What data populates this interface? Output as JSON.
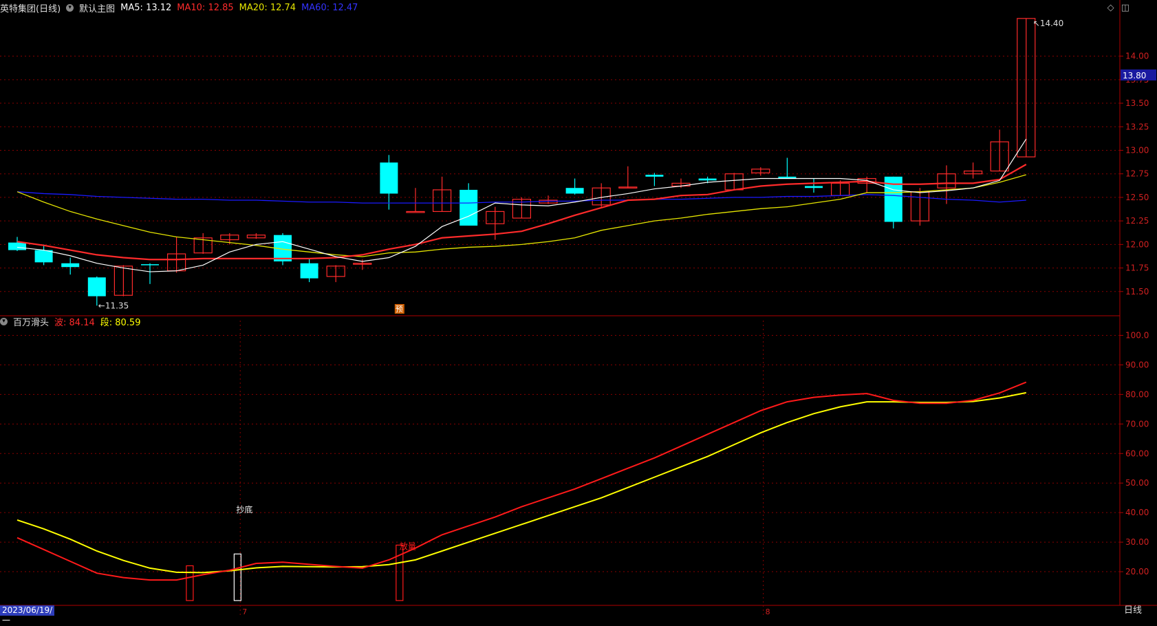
{
  "main_header": {
    "stock_name": "英特集团(日线)",
    "main_chart_label": "默认主图",
    "ma5_label": "MA5: 13.12",
    "ma10_label": "MA10: 12.85",
    "ma20_label": "MA20: 12.74",
    "ma60_label": "MA60: 12.47"
  },
  "sub_header": {
    "indicator_name": "百万滑头",
    "wave_label": "波: 84.14",
    "segment_label": "段: 80.59"
  },
  "bottom": {
    "date": "2023/06/19/一",
    "period": "日线",
    "month_markers": [
      "7",
      "8"
    ]
  },
  "current_price_label": "13.80",
  "colors": {
    "up": "#ff2b2b",
    "down": "#00ffff",
    "ma5": "#ffffff",
    "ma10": "#ff2b2b",
    "ma20": "#e6e600",
    "ma60": "#1a1aff",
    "wave": "#ff1a1a",
    "segment": "#ffff00",
    "grid": "#8b0000"
  },
  "chart_data": [
    {
      "type": "candlestick",
      "ylim": [
        11.25,
        14.45
      ],
      "ticks": [
        11.5,
        11.75,
        12.0,
        12.25,
        12.5,
        12.75,
        13.0,
        13.25,
        13.5,
        13.75,
        14.0
      ],
      "tick_labels": [
        "11.50",
        "11.75",
        "12.00",
        "12.25",
        "12.50",
        "12.75",
        "13.00",
        "13.25",
        "13.50",
        "13.75",
        "14.00"
      ],
      "ohlc": [
        [
          12.02,
          12.08,
          11.93,
          11.94
        ],
        [
          11.94,
          12.0,
          11.78,
          11.81
        ],
        [
          11.8,
          11.86,
          11.68,
          11.76
        ],
        [
          11.65,
          11.66,
          11.35,
          11.45
        ],
        [
          11.46,
          11.78,
          11.45,
          11.77
        ],
        [
          11.79,
          11.8,
          11.58,
          11.78
        ],
        [
          11.72,
          12.08,
          11.7,
          11.9
        ],
        [
          11.91,
          12.12,
          11.9,
          12.07
        ],
        [
          12.05,
          12.12,
          12.0,
          12.1
        ],
        [
          12.07,
          12.12,
          12.06,
          12.1
        ],
        [
          12.1,
          12.12,
          11.78,
          11.82
        ],
        [
          11.8,
          11.85,
          11.6,
          11.64
        ],
        [
          11.66,
          11.78,
          11.6,
          11.77
        ],
        [
          11.8,
          11.84,
          11.73,
          11.8
        ],
        [
          12.87,
          12.95,
          12.37,
          12.54
        ],
        [
          12.35,
          12.6,
          12.35,
          12.35
        ],
        [
          12.35,
          12.72,
          12.35,
          12.58
        ],
        [
          12.58,
          12.65,
          12.2,
          12.2
        ],
        [
          12.22,
          12.4,
          12.05,
          12.35
        ],
        [
          12.28,
          12.5,
          12.28,
          12.48
        ],
        [
          12.44,
          12.52,
          12.43,
          12.47
        ],
        [
          12.6,
          12.7,
          12.53,
          12.54
        ],
        [
          12.42,
          12.65,
          12.4,
          12.6
        ],
        [
          12.6,
          12.83,
          12.6,
          12.61
        ],
        [
          12.74,
          12.76,
          12.62,
          12.72
        ],
        [
          12.62,
          12.7,
          12.6,
          12.65
        ],
        [
          12.7,
          12.72,
          12.65,
          12.68
        ],
        [
          12.58,
          12.76,
          12.58,
          12.75
        ],
        [
          12.76,
          12.82,
          12.73,
          12.8
        ],
        [
          12.72,
          12.92,
          12.7,
          12.7
        ],
        [
          12.62,
          12.7,
          12.55,
          12.6
        ],
        [
          12.52,
          12.68,
          12.52,
          12.65
        ],
        [
          12.65,
          12.72,
          12.55,
          12.7
        ],
        [
          12.72,
          12.72,
          12.17,
          12.24
        ],
        [
          12.25,
          12.6,
          12.2,
          12.56
        ],
        [
          12.6,
          12.84,
          12.43,
          12.75
        ],
        [
          12.75,
          12.87,
          12.7,
          12.78
        ],
        [
          12.78,
          13.22,
          12.78,
          13.09
        ],
        [
          12.93,
          14.4,
          12.93,
          14.4
        ]
      ],
      "ma5": [
        11.97,
        11.94,
        11.88,
        11.8,
        11.75,
        11.71,
        11.72,
        11.78,
        11.92,
        12.0,
        12.03,
        11.95,
        11.87,
        11.82,
        11.86,
        11.98,
        12.19,
        12.3,
        12.44,
        12.42,
        12.41,
        12.45,
        12.5,
        12.54,
        12.59,
        12.62,
        12.66,
        12.68,
        12.7,
        12.7,
        12.7,
        12.7,
        12.68,
        12.58,
        12.55,
        12.57,
        12.6,
        12.68,
        13.12
      ],
      "ma10": [
        12.03,
        11.99,
        11.94,
        11.89,
        11.86,
        11.84,
        11.84,
        11.85,
        11.85,
        11.85,
        11.85,
        11.85,
        11.86,
        11.89,
        11.95,
        12.0,
        12.07,
        12.09,
        12.11,
        12.14,
        12.22,
        12.31,
        12.39,
        12.47,
        12.48,
        12.52,
        12.53,
        12.58,
        12.62,
        12.64,
        12.65,
        12.66,
        12.67,
        12.64,
        12.64,
        12.65,
        12.65,
        12.69,
        12.85
      ],
      "ma20": [
        12.56,
        12.45,
        12.35,
        12.27,
        12.2,
        12.13,
        12.08,
        12.05,
        12.02,
        11.99,
        11.95,
        11.92,
        11.89,
        11.87,
        11.91,
        11.92,
        11.95,
        11.97,
        11.98,
        12.0,
        12.03,
        12.07,
        12.15,
        12.2,
        12.25,
        12.28,
        12.32,
        12.35,
        12.38,
        12.4,
        12.44,
        12.48,
        12.55,
        12.55,
        12.56,
        12.58,
        12.6,
        12.66,
        12.74
      ],
      "ma60": [
        12.56,
        12.54,
        12.53,
        12.51,
        12.5,
        12.49,
        12.48,
        12.48,
        12.47,
        12.47,
        12.46,
        12.45,
        12.45,
        12.44,
        12.44,
        12.44,
        12.44,
        12.44,
        12.45,
        12.45,
        12.46,
        12.46,
        12.47,
        12.47,
        12.48,
        12.48,
        12.49,
        12.5,
        12.5,
        12.51,
        12.51,
        12.52,
        12.53,
        12.52,
        12.5,
        12.48,
        12.47,
        12.45,
        12.47
      ],
      "annotations": {
        "low_label": "11.35",
        "high_label": "14.40",
        "forecast_marker": "预"
      }
    },
    {
      "type": "line",
      "ylim": [
        10,
        105
      ],
      "ticks": [
        20,
        30,
        40,
        50,
        60,
        70,
        80,
        90,
        100
      ],
      "tick_labels": [
        "20.00",
        "30.00",
        "40.00",
        "50.00",
        "60.00",
        "70.00",
        "80.00",
        "90.00",
        "100.0"
      ],
      "series": [
        {
          "name": "波",
          "values": [
            31.5,
            27.5,
            23.5,
            19.5,
            18.0,
            17.2,
            17.2,
            19.0,
            20.5,
            22.8,
            23.2,
            22.5,
            21.8,
            21.2,
            24.0,
            28.0,
            32.5,
            35.5,
            38.5,
            42.0,
            45.0,
            48.0,
            51.5,
            55.0,
            58.5,
            62.5,
            66.5,
            70.5,
            74.5,
            77.5,
            79.0,
            79.8,
            80.3,
            78.0,
            77.0,
            77.0,
            78.0,
            80.5,
            84.14
          ]
        },
        {
          "name": "段",
          "values": [
            37.5,
            34.5,
            31.0,
            27.0,
            23.8,
            21.2,
            19.8,
            19.7,
            20.3,
            21.3,
            21.8,
            21.7,
            21.6,
            21.7,
            22.4,
            24.0,
            27.0,
            30.0,
            33.0,
            36.0,
            39.0,
            42.0,
            45.0,
            48.5,
            52.0,
            55.5,
            59.0,
            63.0,
            67.0,
            70.5,
            73.5,
            75.8,
            77.5,
            77.5,
            77.3,
            77.3,
            77.6,
            78.8,
            80.59
          ]
        }
      ],
      "bars": [
        {
          "index": 6.5,
          "value": 22,
          "color": "red"
        },
        {
          "index": 8.3,
          "value": 26,
          "color": "white",
          "label": "抄底"
        },
        {
          "index": 14.4,
          "value": 29,
          "color": "red",
          "label": "放量"
        }
      ]
    }
  ]
}
